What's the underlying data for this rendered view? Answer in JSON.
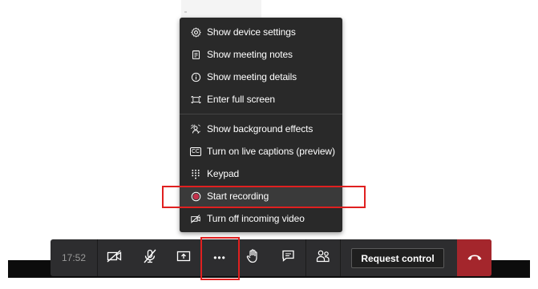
{
  "menu": {
    "items": [
      {
        "label": "Show device settings",
        "icon": "gear-icon"
      },
      {
        "label": "Show meeting notes",
        "icon": "notes-icon"
      },
      {
        "label": "Show meeting details",
        "icon": "info-icon"
      },
      {
        "label": "Enter full screen",
        "icon": "fullscreen-icon"
      },
      {
        "label": "Show background effects",
        "icon": "background-effects-icon"
      },
      {
        "label": "Turn on live captions (preview)",
        "icon": "captions-icon"
      },
      {
        "label": "Keypad",
        "icon": "keypad-icon"
      },
      {
        "label": "Start recording",
        "icon": "record-icon"
      },
      {
        "label": "Turn off incoming video",
        "icon": "video-off-icon"
      }
    ],
    "captions_icon_text": "CC"
  },
  "toolbar": {
    "timer": "17:52",
    "request_control_label": "Request control",
    "more_label": "•••"
  },
  "colors": {
    "menu_bg": "#292929",
    "toolbar_bg": "#2d2d2f",
    "hangup": "#a4262c",
    "annotation": "#e02020",
    "record_dot": "#c4314b"
  }
}
